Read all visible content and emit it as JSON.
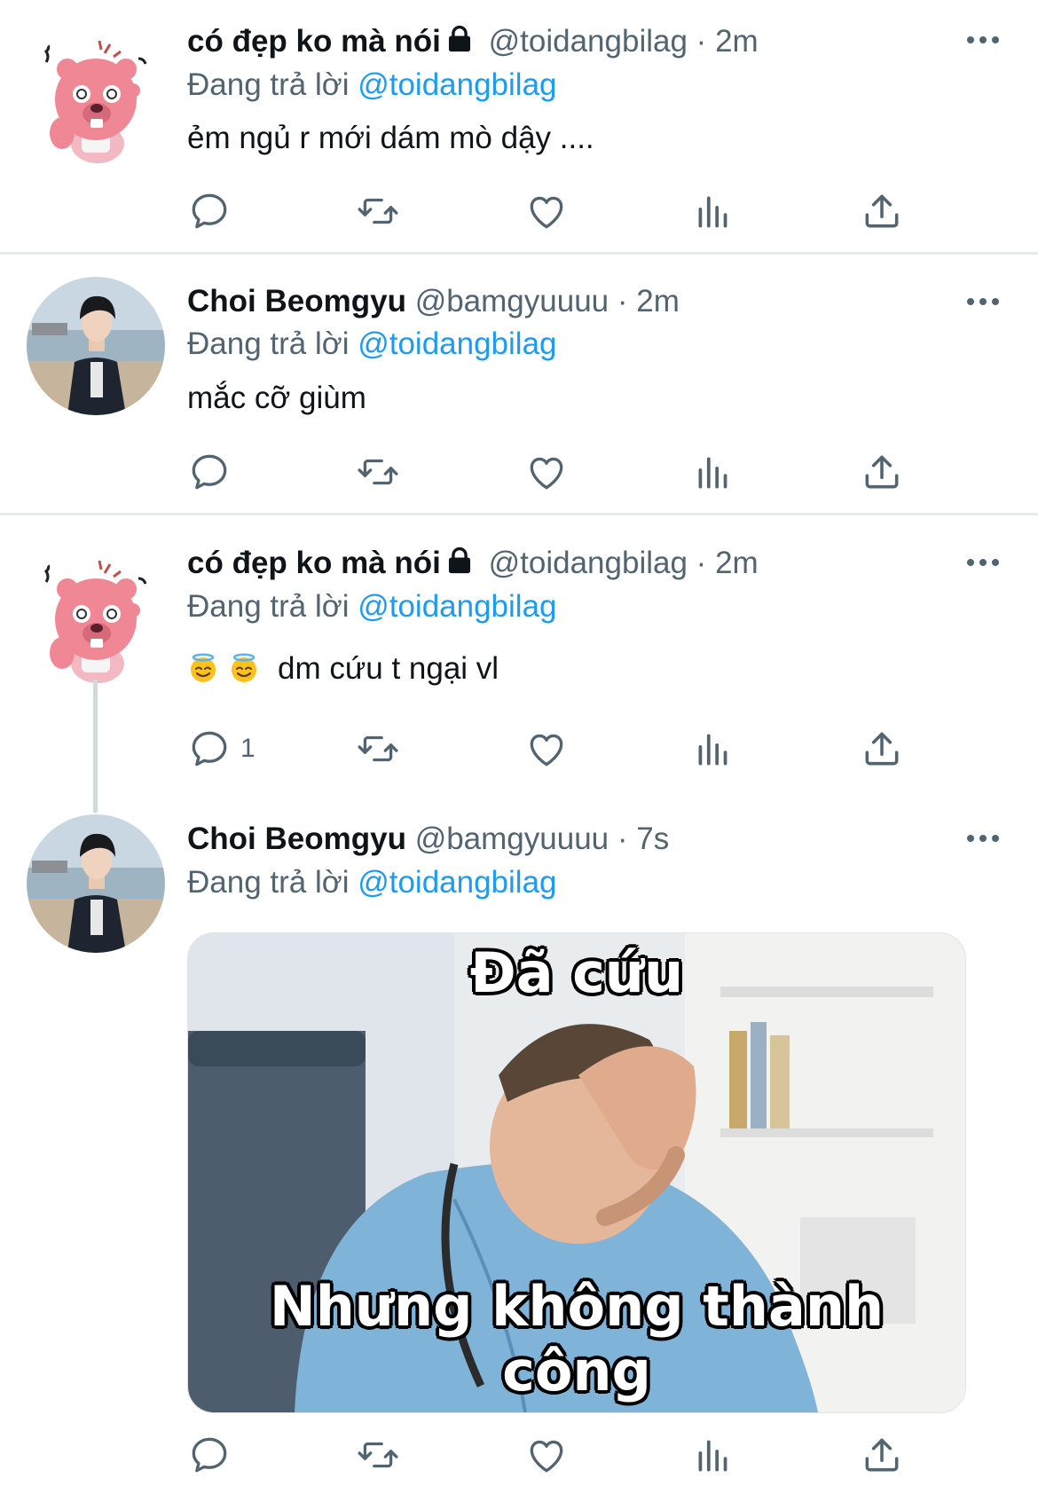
{
  "tweets": [
    {
      "display_name": "có đẹp ko mà nói",
      "locked": true,
      "handle": "@toidangbilag",
      "separator": "·",
      "time": "2m",
      "replying_label": "Đang trả lời",
      "replying_to": "@toidangbilag",
      "text": "ẻm ngủ r mới dám mò dậy ....",
      "reply_count": ""
    },
    {
      "display_name": "Choi Beomgyu",
      "locked": false,
      "handle": "@bamgyuuuu",
      "separator": "·",
      "time": "2m",
      "replying_label": "Đang trả lời",
      "replying_to": "@toidangbilag",
      "text": "mắc cỡ giùm",
      "reply_count": ""
    },
    {
      "display_name": "có đẹp ko mà nói",
      "locked": true,
      "handle": "@toidangbilag",
      "separator": "·",
      "time": "2m",
      "replying_label": "Đang trả lời",
      "replying_to": "@toidangbilag",
      "text": "dm cứu t ngại vl",
      "emoji": [
        "smiling-face-with-halo",
        "smiling-face-with-halo"
      ],
      "reply_count": "1"
    },
    {
      "display_name": "Choi Beomgyu",
      "locked": false,
      "handle": "@bamgyuuuu",
      "separator": "·",
      "time": "7s",
      "replying_label": "Đang trả lời",
      "replying_to": "@toidangbilag",
      "media": {
        "top_caption": "Đã cứu",
        "bottom_caption": "Nhưng không thành công"
      },
      "reply_count": ""
    }
  ],
  "icons": {
    "more": "more-icon",
    "reply": "reply-icon",
    "retweet": "retweet-icon",
    "like": "heart-icon",
    "views": "views-icon",
    "share": "share-icon",
    "lock": "lock-icon"
  },
  "colors": {
    "mention": "#1d9bf0",
    "secondary": "#536471",
    "divider": "#e7e9ec"
  }
}
